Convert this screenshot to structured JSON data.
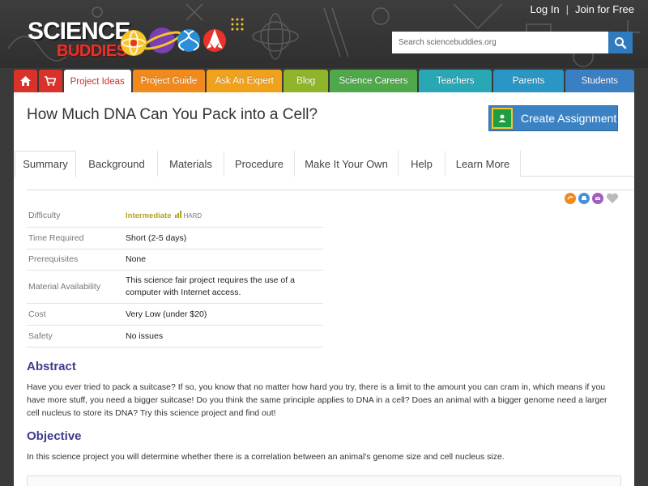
{
  "header": {
    "logo_science": "SCIENCE",
    "logo_buddies": "BUDDIES",
    "login": "Log In",
    "separator": "|",
    "join": "Join for Free",
    "search_placeholder": "Search sciencebuddies.org"
  },
  "nav": {
    "items": [
      {
        "label": "",
        "icon": "home-icon",
        "color": "#d9322a"
      },
      {
        "label": "",
        "icon": "cart-icon",
        "color": "#d9322a"
      },
      {
        "label": "Project Ideas",
        "color": "#ffffff"
      },
      {
        "label": "Project Guide",
        "color": "#f08a1c"
      },
      {
        "label": "Ask An Expert",
        "color": "#f0a21c"
      },
      {
        "label": "Blog",
        "color": "#8fb52a"
      },
      {
        "label": "Science Careers",
        "color": "#4fa84a"
      },
      {
        "label": "Teachers",
        "color": "#2aa7b5"
      },
      {
        "label": "Parents",
        "color": "#2a96c5"
      },
      {
        "label": "Students",
        "color": "#3a7ec4"
      }
    ],
    "active_index": 2
  },
  "page": {
    "title": "How Much DNA Can You Pack into a Cell?",
    "create_assignment": "Create Assignment"
  },
  "tabs": [
    "Summary",
    "Background",
    "Materials",
    "Procedure",
    "Make It Your Own",
    "Help",
    "Learn More"
  ],
  "summary": {
    "rows": [
      {
        "label": "Difficulty",
        "value": "Intermediate",
        "extra": "HARD"
      },
      {
        "label": "Time Required",
        "value": "Short (2-5 days)"
      },
      {
        "label": "Prerequisites",
        "value": "None"
      },
      {
        "label": "Material Availability",
        "value": "This science fair project requires the use of a computer with Internet access."
      },
      {
        "label": "Cost",
        "value": "Very Low (under $20)"
      },
      {
        "label": "Safety",
        "value": "No issues"
      }
    ]
  },
  "abstract": {
    "title": "Abstract",
    "text": "Have you ever tried to pack a suitcase? If so, you know that no matter how hard you try, there is a limit to the amount you can cram in, which means if you have more stuff, you need a bigger suitcase! Do you think the same principle applies to DNA in a cell? Does an animal with a bigger genome need a larger cell nucleus to store its DNA? Try this science project and find out!"
  },
  "objective": {
    "title": "Objective",
    "text": "In this science project you will determine whether there is a correlation between an animal's genome size and cell nucleus size."
  },
  "colors": {
    "accent_blue": "#3b82c4",
    "heading_purple": "#3f3a8c",
    "difficulty_gold": "#b6a11b"
  }
}
